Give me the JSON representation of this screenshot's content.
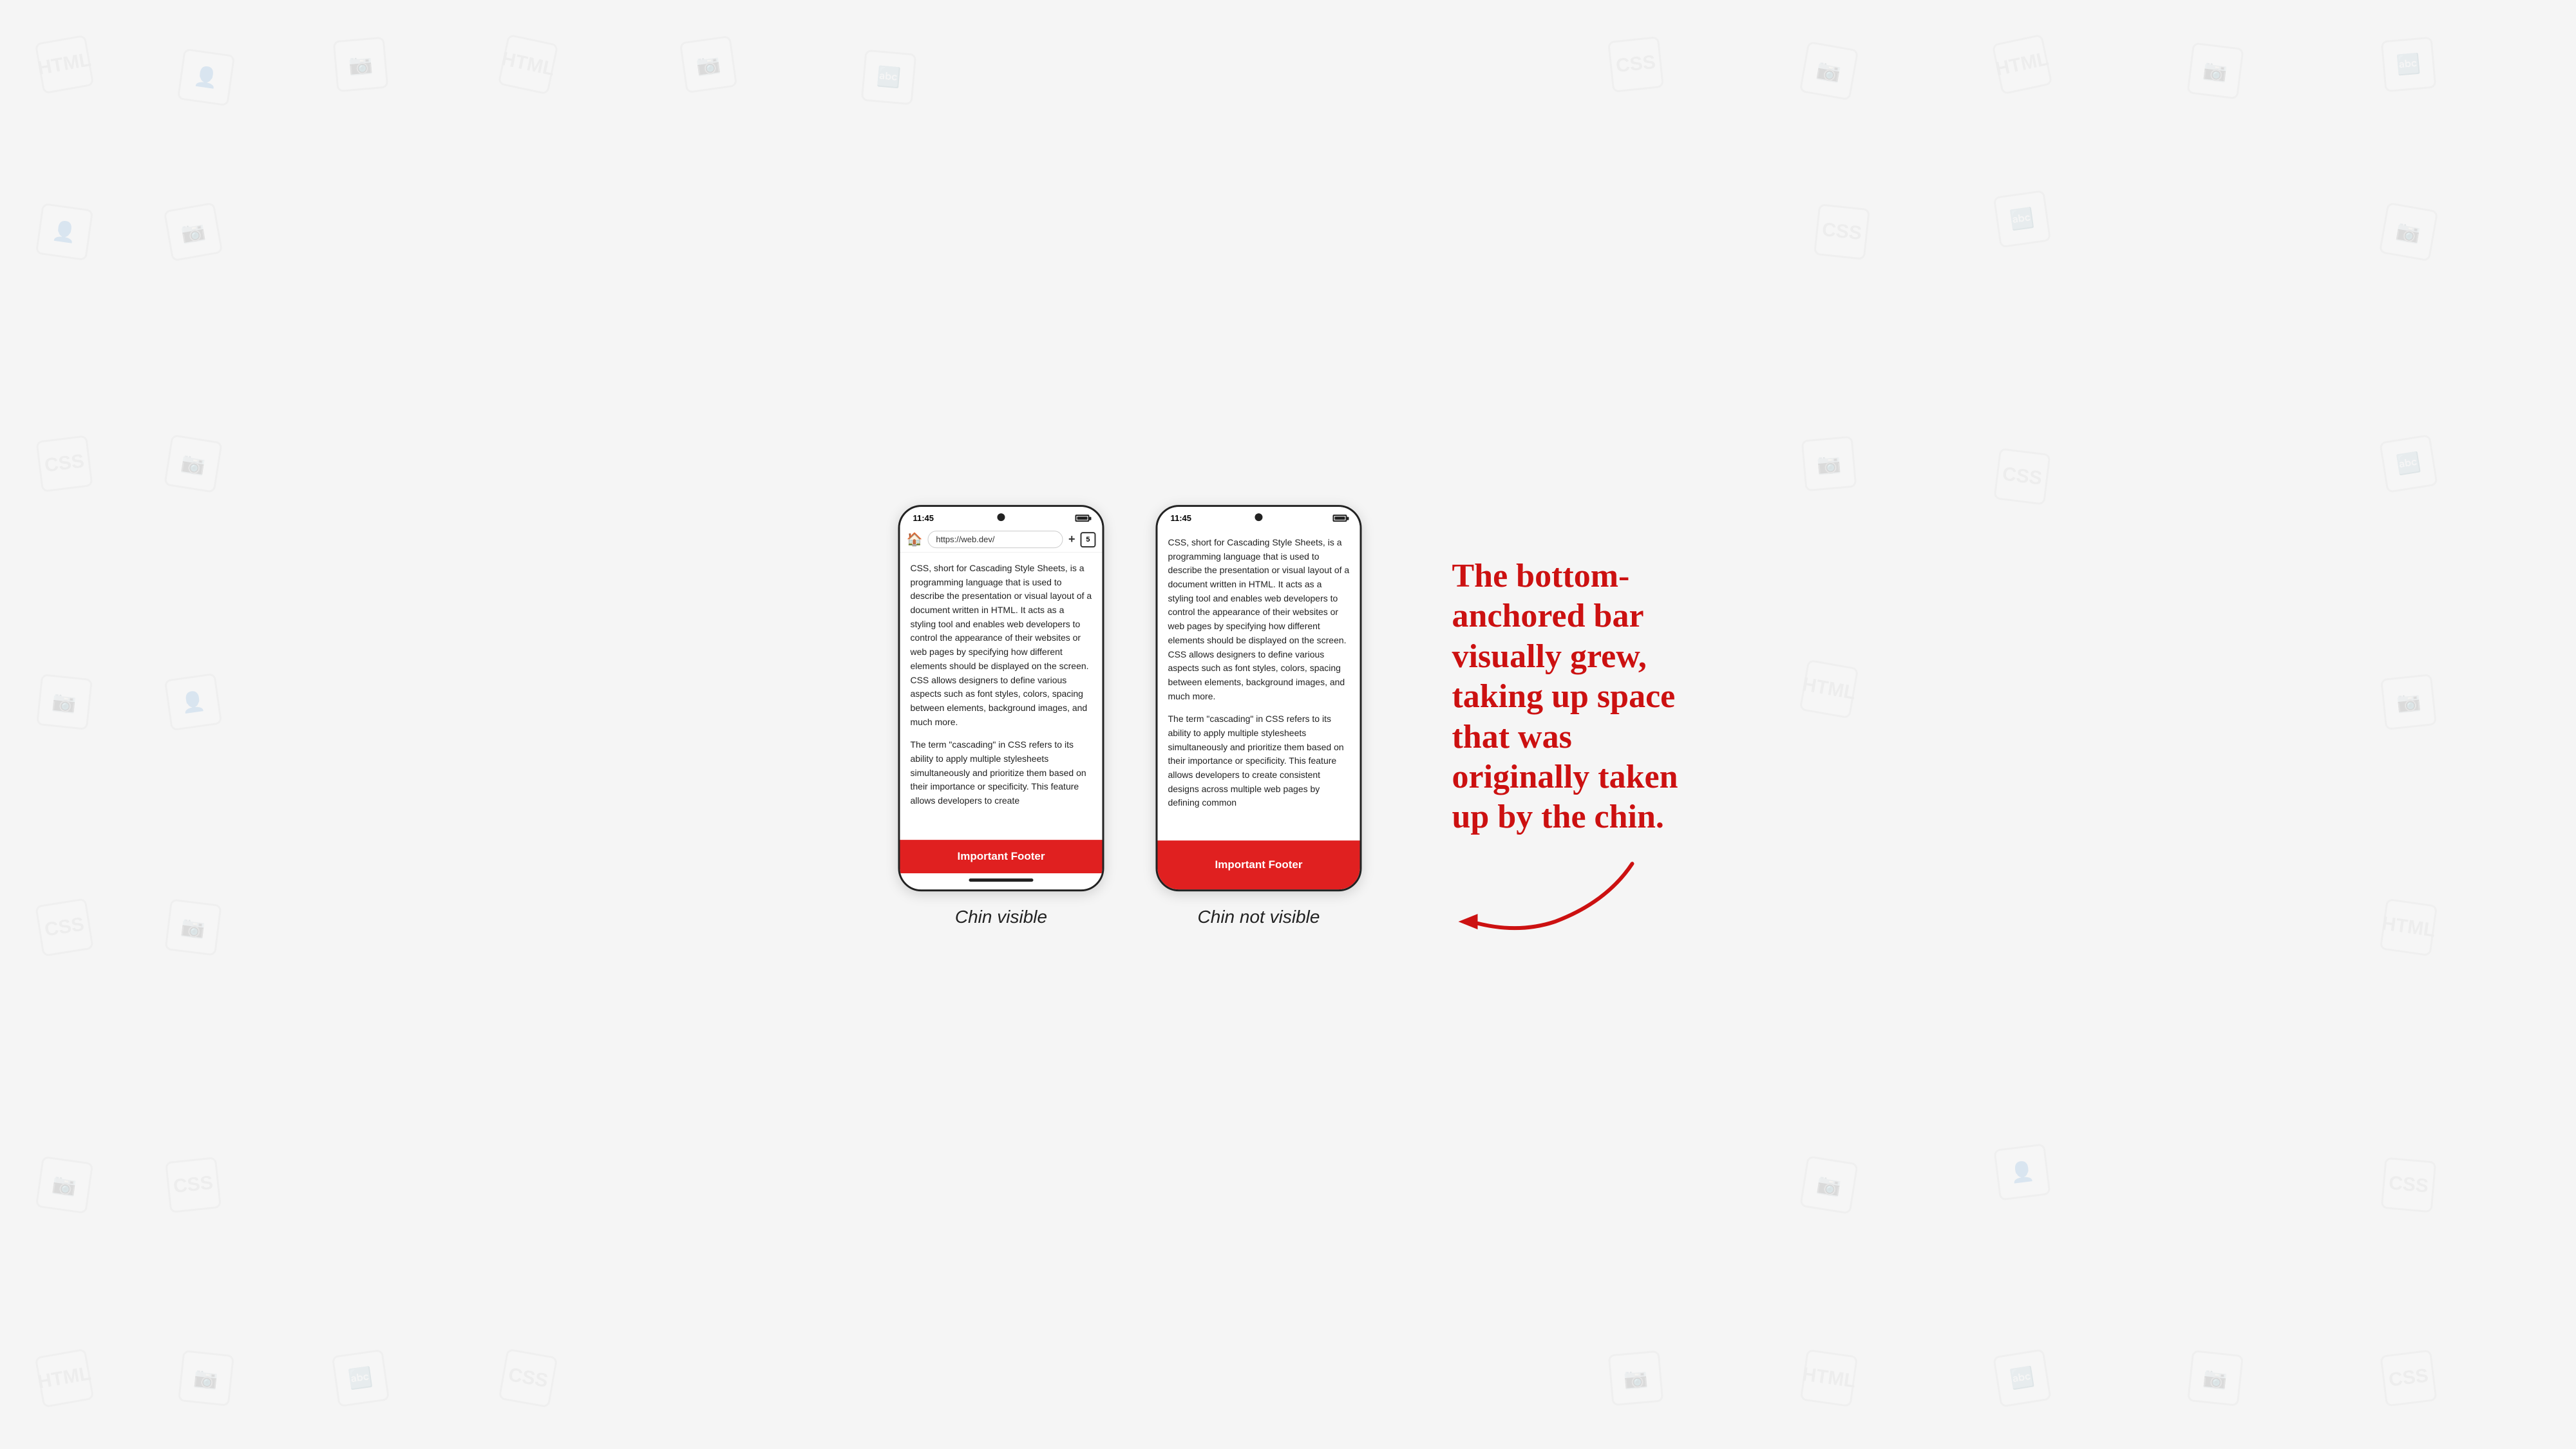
{
  "background": {
    "color": "#f5f5f5"
  },
  "phones": [
    {
      "id": "chin-visible",
      "caption": "Chin visible",
      "status": {
        "time": "11:45",
        "battery": true
      },
      "has_address_bar": true,
      "address_bar": {
        "url": "https://web.dev/",
        "tab_count": "5"
      },
      "has_chin": true,
      "content_paragraphs": [
        "CSS, short for Cascading Style Sheets, is a programming language that is used to describe the presentation or visual layout of a document written in HTML. It acts as a styling tool and enables web developers to control the appearance of their websites or web pages by specifying how different elements should be displayed on the screen. CSS allows designers to define various aspects such as font styles, colors, spacing between elements, background images, and much more.",
        "The term \"cascading\" in CSS refers to its ability to apply multiple stylesheets simultaneously and prioritize them based on their importance or specificity. This feature allows developers to create"
      ],
      "footer": {
        "label": "Important Footer"
      }
    },
    {
      "id": "chin-not-visible",
      "caption": "Chin not visible",
      "status": {
        "time": "11:45",
        "battery": true
      },
      "has_address_bar": false,
      "has_chin": false,
      "content_paragraphs": [
        "CSS, short for Cascading Style Sheets, is a programming language that is used to describe the presentation or visual layout of a document written in HTML. It acts as a styling tool and enables web developers to control the appearance of their websites or web pages by specifying how different elements should be displayed on the screen. CSS allows designers to define various aspects such as font styles, colors, spacing between elements, background images, and much more.",
        "The term \"cascading\" in CSS refers to its ability to apply multiple stylesheets simultaneously and prioritize them based on their importance or specificity. This feature allows developers to create consistent designs across multiple web pages by defining common"
      ],
      "footer": {
        "label": "Important Footer"
      }
    }
  ],
  "annotation": {
    "lines": [
      "The bottom-",
      "anchored bar",
      "visually grew,",
      "taking up space",
      "that was",
      "originally taken",
      "up by the chin."
    ],
    "full_text": "The bottom-anchored bar visually grew, taking up space that was originally taken up by the chin.",
    "color": "#cc1111"
  }
}
